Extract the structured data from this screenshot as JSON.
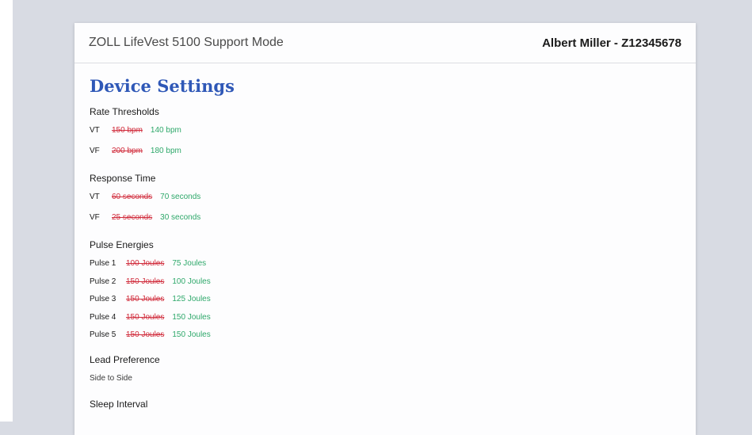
{
  "header": {
    "app_title": "ZOLL LifeVest 5100 Support Mode",
    "patient": "Albert Miller - Z12345678"
  },
  "page_title": "Device Settings",
  "rate_thresholds": {
    "title": "Rate Thresholds",
    "rows": [
      {
        "label": "VT",
        "old": "150 bpm",
        "new": "140 bpm"
      },
      {
        "label": "VF",
        "old": "200 bpm",
        "new": "180 bpm"
      }
    ]
  },
  "response_time": {
    "title": "Response Time",
    "rows": [
      {
        "label": "VT",
        "old": "60 seconds",
        "new": "70 seconds"
      },
      {
        "label": "VF",
        "old": "25 seconds",
        "new": "30 seconds"
      }
    ]
  },
  "pulse_energies": {
    "title": "Pulse Energies",
    "rows": [
      {
        "label": "Pulse 1",
        "old": "100 Joules",
        "new": "75 Joules"
      },
      {
        "label": "Pulse 2",
        "old": "150 Joules",
        "new": "100 Joules"
      },
      {
        "label": "Pulse 3",
        "old": "150 Joules",
        "new": "125 Joules"
      },
      {
        "label": "Pulse 4",
        "old": "150 Joules",
        "new": "150 Joules"
      },
      {
        "label": "Pulse 5",
        "old": "150 Joules",
        "new": "150 Joules"
      }
    ]
  },
  "lead_preference": {
    "title": "Lead Preference",
    "value": "Side to Side"
  },
  "sleep_interval": {
    "title": "Sleep Interval"
  },
  "colors": {
    "accent": "#2f58b7",
    "old_value": "#d02a3a",
    "new_value": "#2ea86a"
  }
}
